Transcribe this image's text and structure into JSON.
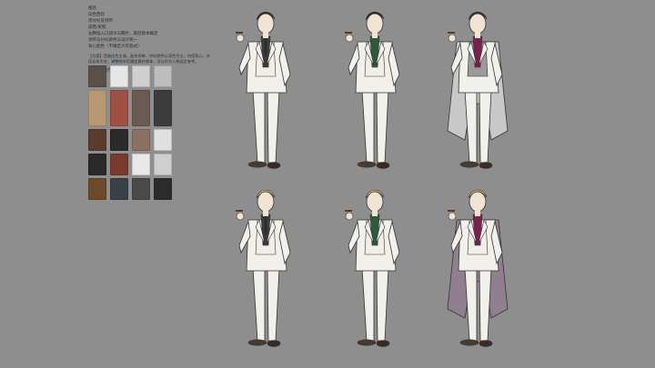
{
  "notes": {
    "lines": [
      "服装",
      "白色西装",
      "黑衬衫及领带",
      "皮鞋/皮鞋",
      "左胸插入口袋巾与胸针，最后版本确定",
      "领带与衬衫颜色与设计统一",
      "背心配色（不确定大衣款式）"
    ],
    "paragraph_1": "【方案】西装白色主调，配合领带、衬衫颜色以深色为主，内搭背心，外搭长款大衣，调整细节后确定最终版本，可以作为人物设定参考。",
    "paragraph_2": "【备注】白色 西装 领带"
  },
  "reference_colors": [
    "#5a5048",
    "#e6e6e6",
    "#cfcfcf",
    "#bdbdbd",
    "#b89870",
    "#a05040",
    "#6a5a50",
    "#3c3c3c",
    "#5a3c2c",
    "#2a2a2a",
    "#8c7060",
    "#e0e0e0",
    "#2a2a2a",
    "#7a3a2a",
    "#e8e8e8",
    "#cfcfcf",
    "#6a4a2a",
    "#3a4048",
    "#4a4a4a",
    "#2c2c2c"
  ],
  "figures": [
    {
      "hair": "#2b2b2b",
      "shirt": "#3a3a3a",
      "vest": "#f1eee6",
      "coat": "none",
      "tie": "#2a2a2a"
    },
    {
      "hair": "#262626",
      "shirt": "#2e5a3a",
      "vest": "#f1eee6",
      "coat": "none",
      "tie": "#2e5a3a"
    },
    {
      "hair": "#2b2b2b",
      "shirt": "#7a2050",
      "vest": "#9a9a9a",
      "coat": "#c8c8c8",
      "tie": "#7a2050"
    },
    {
      "hair": "#d8c07a",
      "shirt": "#3a3a3a",
      "vest": "#f1eee6",
      "coat": "none",
      "tie": "#2a2a2a"
    },
    {
      "hair": "#d8c07a",
      "shirt": "#2e5a3a",
      "vest": "#f1eee6",
      "coat": "none",
      "tie": "#2e5a3a"
    },
    {
      "hair": "#d8c07a",
      "shirt": "#7a2050",
      "vest": "#f1eee6",
      "coat": "#8f7f8f",
      "tie": "#7a2050"
    }
  ]
}
